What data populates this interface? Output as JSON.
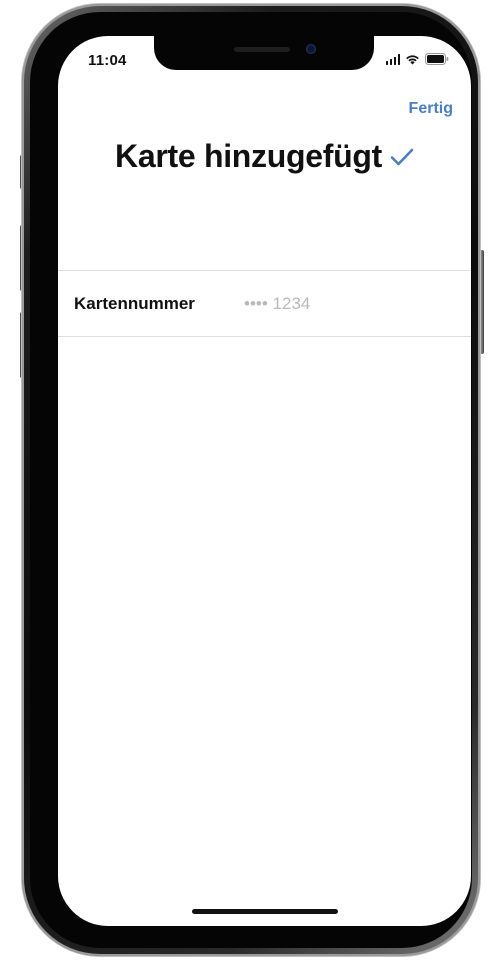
{
  "status_bar": {
    "time": "11:04",
    "icons": [
      "signal-icon",
      "wifi-icon",
      "battery-icon"
    ]
  },
  "nav": {
    "done_label": "Fertig"
  },
  "header": {
    "title": "Karte hinzugefügt",
    "title_icon": "checkmark-icon"
  },
  "card_details": {
    "label": "Kartennummer",
    "value": "•••• 1234"
  },
  "colors": {
    "accent": "#4a7fc1",
    "text": "#111111",
    "muted_value": "#b9b9b9",
    "divider": "#dedede"
  }
}
